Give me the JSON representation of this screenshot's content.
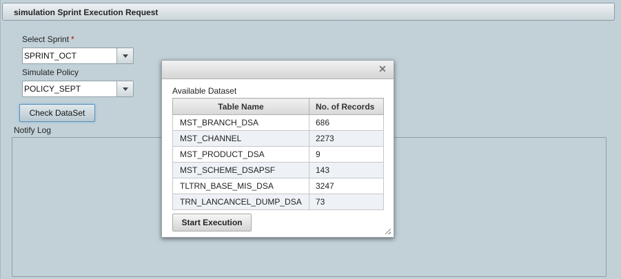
{
  "panel": {
    "title": "simulation Sprint Execution Request"
  },
  "form": {
    "select_sprint_label": "Select Sprint",
    "required_mark": "*",
    "sprint_value": "SPRINT_OCT",
    "simulate_policy_label": "Simulate Policy",
    "policy_value": "POLICY_SEPT",
    "check_dataset_label": "Check DataSet",
    "notify_log_label": "Notify Log"
  },
  "dialog": {
    "close_icon": "close-icon",
    "dataset_label": "Available Dataset",
    "columns": [
      "Table Name",
      "No. of Records"
    ],
    "rows": [
      {
        "name": "MST_BRANCH_DSA",
        "records": "686"
      },
      {
        "name": "MST_CHANNEL",
        "records": "2273"
      },
      {
        "name": "MST_PRODUCT_DSA",
        "records": "9"
      },
      {
        "name": "MST_SCHEME_DSAPSF",
        "records": "143"
      },
      {
        "name": "TLTRN_BASE_MIS_DSA",
        "records": "3247"
      },
      {
        "name": "TRN_LANCANCEL_DUMP_DSA",
        "records": "73"
      }
    ],
    "start_button_label": "Start Execution"
  },
  "colors": {
    "background": "#c2d1d8",
    "required": "#cc0000",
    "focus_border": "#5d8fb9"
  }
}
